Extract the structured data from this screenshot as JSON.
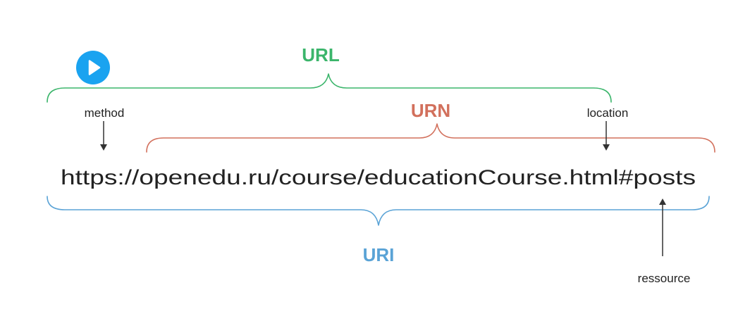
{
  "colors": {
    "url": "#3bb56b",
    "urn": "#d2705c",
    "uri": "#5aa3d6",
    "text": "#222222",
    "arrow": "#333333",
    "play_button": "#1aa3f0"
  },
  "labels": {
    "url": "URL",
    "urn": "URN",
    "uri": "URI"
  },
  "address": "https://openedu.ru/course/educationCourse.html#posts",
  "annotations": {
    "method": "method",
    "location": "location",
    "resource": "ressource"
  },
  "play_button": {
    "icon": "play-icon"
  }
}
